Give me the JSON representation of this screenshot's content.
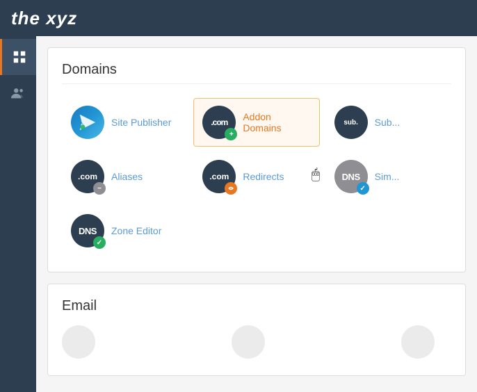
{
  "header": {
    "logo": "the xyz"
  },
  "sidebar": {
    "items": [
      {
        "id": "grid",
        "icon": "grid-icon",
        "active": true
      },
      {
        "id": "users",
        "icon": "users-icon",
        "active": false
      }
    ]
  },
  "domains_section": {
    "title": "Domains",
    "items": [
      {
        "id": "site-publisher",
        "label": "Site Publisher",
        "label_color": "blue",
        "highlighted": false
      },
      {
        "id": "addon-domains",
        "label": "Addon Domains",
        "label_color": "orange",
        "highlighted": true
      },
      {
        "id": "subdomains",
        "label": "Sub...",
        "label_color": "blue",
        "highlighted": false
      },
      {
        "id": "aliases",
        "label": "Aliases",
        "label_color": "blue",
        "highlighted": false
      },
      {
        "id": "redirects",
        "label": "Redirects",
        "label_color": "blue",
        "highlighted": false
      },
      {
        "id": "simple-dns",
        "label": "Sim...",
        "label_color": "blue",
        "highlighted": false
      },
      {
        "id": "zone-editor",
        "label": "Zone Editor",
        "label_color": "blue",
        "highlighted": false
      }
    ]
  },
  "email_section": {
    "title": "Email"
  },
  "icons": {
    "grid": "⊞",
    "users": "👥",
    "plus": "+",
    "check": "✓",
    "minus": "−"
  }
}
